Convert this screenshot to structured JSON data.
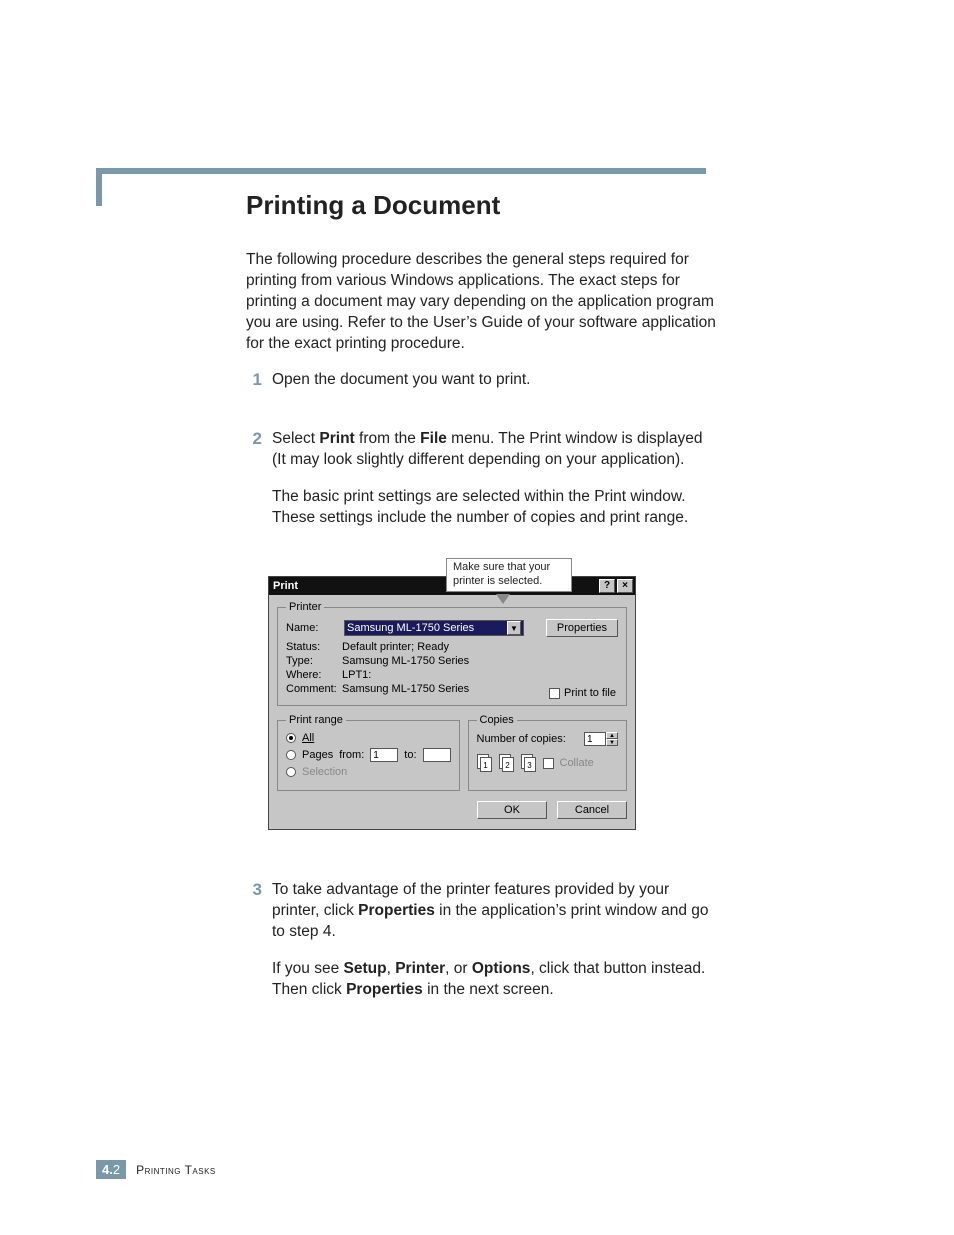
{
  "title": "Printing a Document",
  "intro": "The following procedure describes the general steps required for printing from various Windows applications. The exact steps for printing a document may vary depending on the application program you are using. Refer to the User’s Guide of your software application for the exact printing procedure.",
  "steps": {
    "s1": {
      "num": "1",
      "text": "Open the document you want to print."
    },
    "s2": {
      "num": "2",
      "pre": "Select ",
      "print_word": "Print",
      "mid1": " from the ",
      "file_word": "File",
      "rest1": " menu. The Print window is displayed (It may look slightly different depending on your application).",
      "para2": "The basic print settings are selected within the Print window. These settings include the number of copies and print range."
    },
    "s3": {
      "num": "3",
      "pre": "To take advantage of the printer features provided by your printer, click ",
      "props_word": "Properties",
      "rest1": " in the application’s print window and go to step 4.",
      "p2_pre": "If you see ",
      "setup_word": "Setup",
      "comma1": ", ",
      "printer_word": "Printer",
      "comma2": ", or ",
      "options_word": "Options",
      "p2_mid": ", click that button instead. Then click ",
      "props_word2": "Properties",
      "p2_end": " in the next screen."
    }
  },
  "callout": "Make sure that your printer is selected.",
  "dialog": {
    "title": "Print",
    "help_glyph": "?",
    "close_glyph": "×",
    "printer_legend": "Printer",
    "name_label": "Name:",
    "name_value": "Samsung ML-1750 Series",
    "dropdown_glyph": "▼",
    "properties_btn": "Properties",
    "status_label": "Status:",
    "status_value": "Default printer; Ready",
    "type_label": "Type:",
    "type_value": "Samsung ML-1750 Series",
    "where_label": "Where:",
    "where_value": "LPT1:",
    "comment_label": "Comment:",
    "comment_value": "Samsung ML-1750 Series",
    "print_to_file": "Print to file",
    "range_legend": "Print range",
    "all_label": "All",
    "pages_label": "Pages",
    "from_label": "from:",
    "from_value": "1",
    "to_label": "to:",
    "to_value": "",
    "selection_label": "Selection",
    "copies_legend": "Copies",
    "num_copies_label": "Number of copies:",
    "num_copies_value": "1",
    "spin_up": "▲",
    "spin_down": "▼",
    "collate_label": "Collate",
    "icon1": "1",
    "icon2": "2",
    "icon3": "3",
    "ok_btn": "OK",
    "cancel_btn": "Cancel"
  },
  "footer": {
    "chapter": "4.",
    "page": "2",
    "caption": "Printing Tasks"
  }
}
